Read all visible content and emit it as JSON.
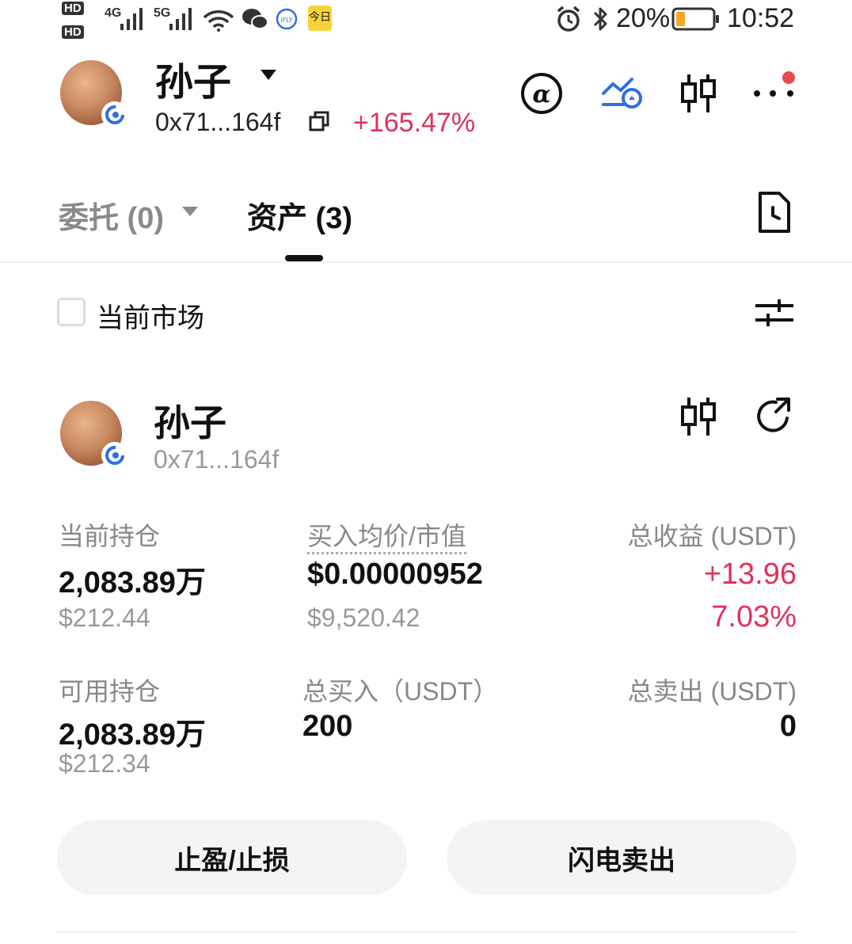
{
  "status_bar": {
    "hd1": "HD",
    "hd2": "HD",
    "sig1": "4G",
    "sig2": "5G",
    "battery": "20%",
    "time": "10:52"
  },
  "header": {
    "name": "孙子",
    "address": "0x71...164f",
    "change": "+165.47%"
  },
  "tabs": {
    "orders": "委托 (0)",
    "assets": "资产 (3)"
  },
  "filter": {
    "current_market": "当前市场"
  },
  "asset": {
    "name": "孙子",
    "address": "0x71...164f",
    "hold_label": "当前持仓",
    "hold_value": "2,083.89万",
    "hold_usd": "$212.44",
    "avg_label": "买入均价/市值",
    "avg_value": "$0.00000952",
    "avg_mv": "$9,520.42",
    "pnl_label": "总收益 (USDT)",
    "pnl_value": "+13.96",
    "pnl_pct": "7.03%",
    "avail_label": "可用持仓",
    "avail_value": "2,083.89万",
    "avail_usd": "$212.34",
    "buy_label": "总买入（USDT）",
    "buy_value": "200",
    "sell_label": "总卖出 (USDT)",
    "sell_value": "0"
  },
  "buttons": {
    "tp_sl": "止盈/止损",
    "flash_sell": "闪电卖出"
  },
  "colors": {
    "red": "#e0325a",
    "blue": "#2f6fe0"
  }
}
